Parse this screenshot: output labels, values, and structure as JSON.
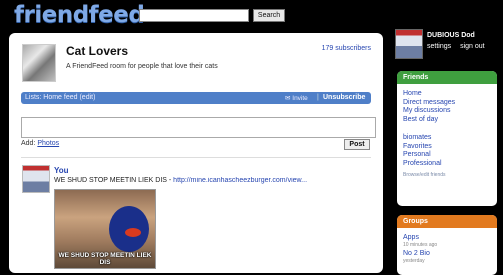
{
  "header": {
    "logo": "friendfeed",
    "search_button": "Search",
    "search_value": ""
  },
  "room": {
    "title": "Cat Lovers",
    "description": "A FriendFeed room for people that love their cats",
    "subscribers": "179 subscribers"
  },
  "list_bar": {
    "label": "Lists: Home feed (edit)",
    "invite": "Invite",
    "separator": "|",
    "unsubscribe": "Unsubscribe"
  },
  "composer": {
    "value": "",
    "add_label": "Add:",
    "add_link": "Photos",
    "post_button": "Post"
  },
  "entry": {
    "user": "You",
    "text": "WE SHUD STOP MEETIN LIEK DIS -",
    "url": "http://mine.icanhascheezburger.com/view...",
    "image_caption": "WE SHUD STOP MEETIN LIEK DIS"
  },
  "me": {
    "name": "DUBIOUS Dod",
    "settings": "settings",
    "sign_out": "sign out"
  },
  "friends": {
    "header": "Friends",
    "links": [
      "Home",
      "Direct messages",
      "My discussions",
      "Best of day"
    ],
    "lists": [
      "biomates",
      "Favorites",
      "Personal",
      "Professional"
    ],
    "browse": "Browse/edit friends"
  },
  "groups": {
    "header": "Groups",
    "items": [
      {
        "name": "Apps",
        "time": "10 minutes ago"
      },
      {
        "name": "No 2 Bio",
        "time": "yesterday"
      }
    ]
  }
}
